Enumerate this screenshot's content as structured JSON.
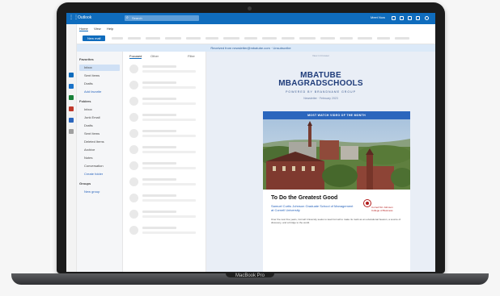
{
  "device": {
    "model_label": "MacBook Pro"
  },
  "outlook": {
    "app_name": "Outlook",
    "search_placeholder": "Search",
    "meet_now": "Meet Now",
    "ribbon_tabs": [
      "Home",
      "View",
      "Help"
    ],
    "new_mail_label": "New mail",
    "banner_text": "Received from newsletter@mbatube.com · Unsubscribe",
    "folders": [
      "Favorites",
      "Inbox",
      "Sent Items",
      "Drafts",
      "Add favorite",
      "Folders",
      "Inbox",
      "Junk Email",
      "Drafts",
      "Sent Items",
      "Deleted Items",
      "Archive",
      "Notes",
      "Conversation",
      "Create folder",
      "Groups",
      "New group"
    ],
    "list_tabs": {
      "focused": "Focused",
      "other": "Other",
      "filter": "Filter"
    },
    "mail_row_count": 11
  },
  "email": {
    "top_note": "View in browser",
    "logo_line1": "MBATUBE",
    "logo_line2": "MBAGRADSCHOOLS",
    "powered_by": "POWERED BY BRANDNAME GROUP",
    "edition": "Newsletter · February 2023",
    "card_header": "MOST WATCH VIDEO OF THE MONTH",
    "story_title": "To Do the Greatest Good",
    "story_subtitle": "Samuel Curtis Johnson Graduate School of Management at Cornell University",
    "sponsor_text": "Cornell SC Johnson College of Business",
    "story_body": "Over the next five years, Cornell University seeks to lead Cornell to make its mark as an educational beacon, a source of discovery, and a bridge to the world."
  }
}
